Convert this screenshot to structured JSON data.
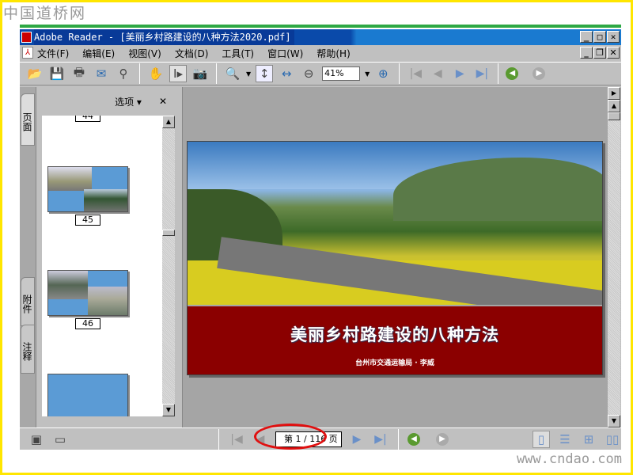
{
  "watermark_top": "中国道桥网",
  "watermark_bottom": "www.cndao.com",
  "window": {
    "app": "Adobe Reader",
    "title": "Adobe Reader - [美丽乡村路建设的八种方法2020.pdf]"
  },
  "menu": [
    "文件(F)",
    "编辑(E)",
    "视图(V)",
    "文档(D)",
    "工具(T)",
    "窗口(W)",
    "帮助(H)"
  ],
  "toolbar": {
    "zoom": "41%"
  },
  "side_tabs": [
    "页面",
    "附件",
    "注释"
  ],
  "panel": {
    "options": "选项 ▾",
    "close": "✕"
  },
  "thumbnails": [
    "44",
    "45",
    "46"
  ],
  "document": {
    "title": "美丽乡村路建设的八种方法",
    "subtitle": "台州市交通运输局 · 李威"
  },
  "status": {
    "page": "第 1 / 116 页"
  },
  "colors": {
    "highlight": "#e01010",
    "cover_red": "#8b0000",
    "titlebar": "#0a4aaa"
  }
}
